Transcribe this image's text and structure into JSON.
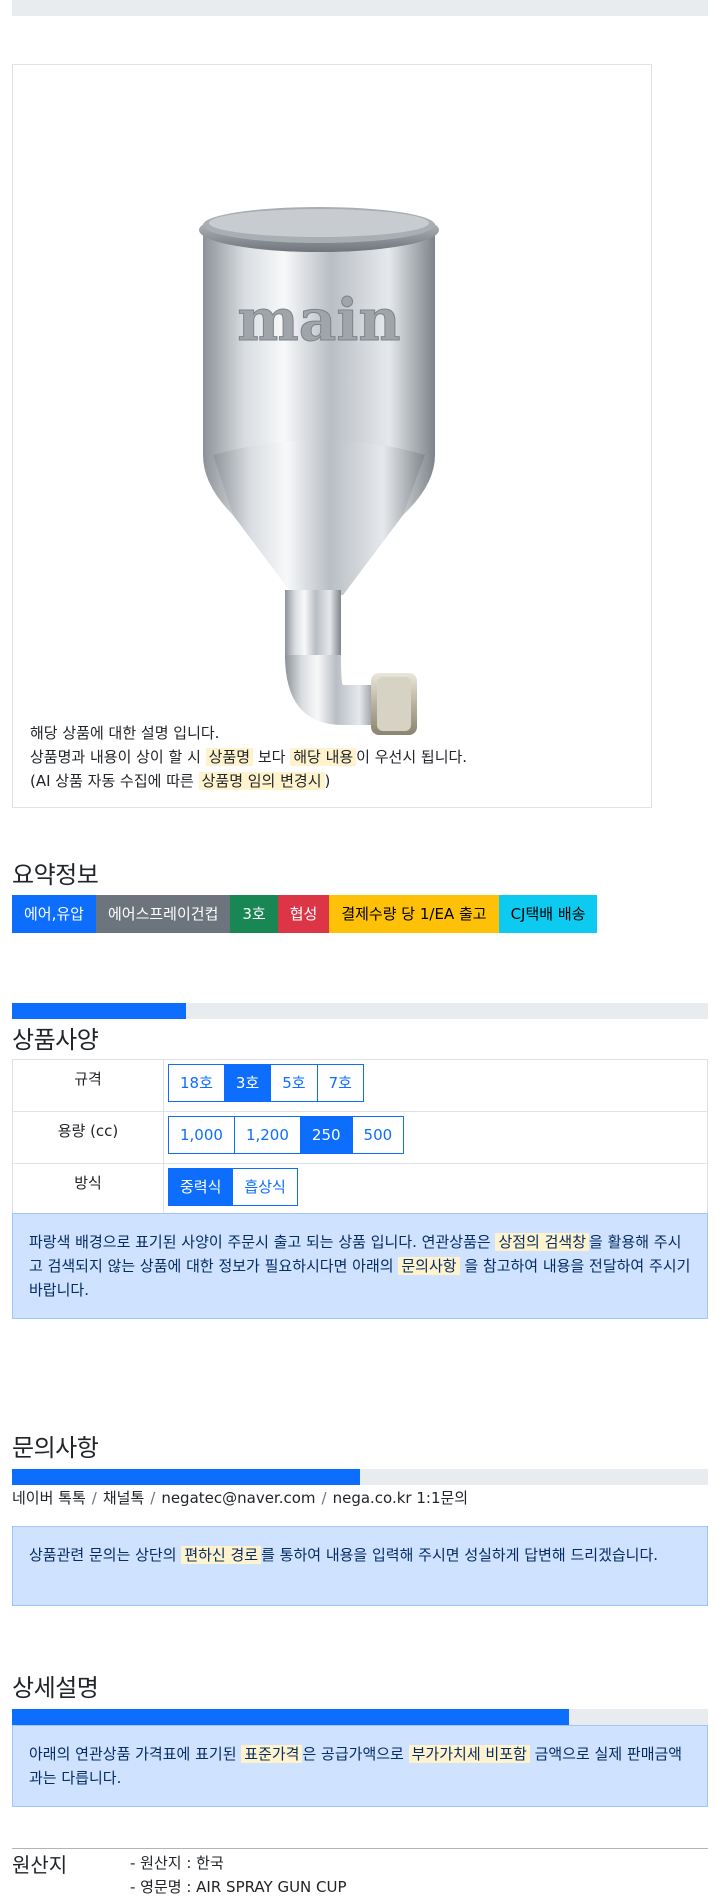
{
  "card": {
    "image_text": "main",
    "line1": "해당 상품에 대한 설명 입니다.",
    "line2_a": "상품명과 내용이 상이 할 시 ",
    "line2_mark1": "상품명",
    "line2_b": " 보다 ",
    "line2_mark2": "해당 내용",
    "line2_c": "이 우선시 됩니다.",
    "line3_a": "(AI 상품 자동 수집에 따른 ",
    "line3_mark": "상품명 임의 변경시",
    "line3_b": ")"
  },
  "summary": {
    "title": "요약정보",
    "badges": [
      {
        "label": "에어,유압",
        "color": "#0d6efd",
        "text_color": "#ffffff"
      },
      {
        "label": "에어스프레이건컵",
        "color": "#6c757d",
        "text_color": "#ffffff"
      },
      {
        "label": "3호",
        "color": "#198754",
        "text_color": "#ffffff"
      },
      {
        "label": "협성",
        "color": "#dc3545",
        "text_color": "#ffffff"
      },
      {
        "label": "결제수량 당 1/EA 출고",
        "color": "#ffc107",
        "text_color": "#000000"
      },
      {
        "label": "CJ택배 배송",
        "color": "#0dcaf0",
        "text_color": "#000000"
      }
    ]
  },
  "spec": {
    "progress_fraction": 0.25,
    "title": "상품사양",
    "rows": [
      {
        "label": "규격",
        "options": [
          "18호",
          "3호",
          "5호",
          "7호"
        ],
        "selected": "3호"
      },
      {
        "label": "용량 (cc)",
        "options": [
          "1,000",
          "1,200",
          "250",
          "500"
        ],
        "selected": "250"
      },
      {
        "label": "방식",
        "options": [
          "중력식",
          "흡상식"
        ],
        "selected": "중력식"
      }
    ],
    "notice_a": "파랑색 배경으로 표기된 사양이 주문시 출고 되는 상품 입니다. 연관상품은 ",
    "notice_mark1": "상점의 검색창",
    "notice_b": "을 활용해 주시고 검색되지 않는 상품에 대한 정보가 필요하시다면 아래의 ",
    "notice_mark2": "문의사항",
    "notice_c": " 을 참고하여 내용을 전달하여 주시기 바랍니다."
  },
  "inquiry": {
    "title": "문의사항",
    "progress_fraction": 0.5,
    "links": [
      "네이버 톡톡",
      "채널톡",
      "negatec@naver.com",
      "nega.co.kr 1:1문의"
    ],
    "notice_a": "상품관련 문의는 상단의 ",
    "notice_mark": "편하신 경로",
    "notice_b": "를 통하여 내용을 입력해 주시면 성실하게 답변해 드리겠습니다."
  },
  "detail": {
    "title": "상세설명",
    "progress_fraction": 0.8,
    "notice_a": "아래의 연관상품 가격표에 표기된 ",
    "notice_mark1": "표준가격",
    "notice_b": "은 공급가액으로 ",
    "notice_mark2": "부가가치세 비포함",
    "notice_c": " 금액으로 실제 판매금액과는 다릅니다."
  },
  "origin": {
    "title": "원산지",
    "items": [
      "- 원산지 : 한국",
      "- 영문명 : AIR SPRAY GUN CUP"
    ]
  }
}
